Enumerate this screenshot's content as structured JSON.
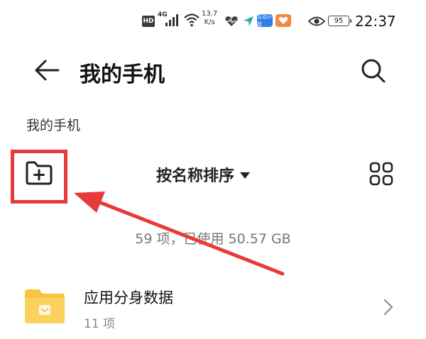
{
  "status_bar": {
    "hd": "HD",
    "network": "4G",
    "speed_value": "13.7",
    "speed_unit": "K/s",
    "app_badge_label": "互动小程",
    "battery": "95",
    "time": "22:37"
  },
  "app_bar": {
    "title": "我的手机"
  },
  "breadcrumb": "我的手机",
  "toolbar": {
    "sort_label": "按名称排序"
  },
  "summary": "59 项，已使用 50.57 GB",
  "files": [
    {
      "name": "应用分身数据",
      "count": "11 项"
    }
  ],
  "colors": {
    "highlight": "#e8393b",
    "folder": "#f9c440",
    "app_badge_blue": "#2b7de9",
    "app_badge_orange": "#f08a3c"
  }
}
